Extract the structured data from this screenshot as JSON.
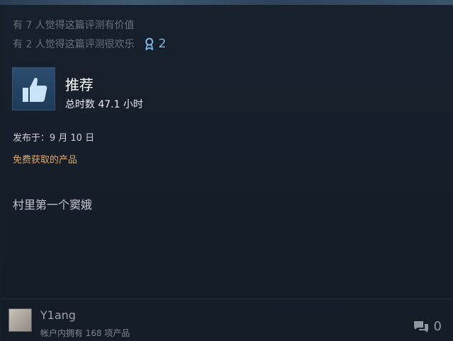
{
  "helpful": {
    "useful_text": "有 7 人觉得这篇评测有价值",
    "funny_text": "有 2 人觉得这篇评测很欢乐",
    "award_count": "2"
  },
  "review": {
    "recommendation": "推荐",
    "playtime": "总时数 47.1 小时",
    "posted": "发布于：9 月 10 日",
    "free_product": "免费获取的产品",
    "body": "村里第一个窦娥"
  },
  "author": {
    "name": "Y1ang",
    "products_owned": "帐户内拥有 168 项产品"
  },
  "comments": {
    "count": "0"
  },
  "icons": {
    "thumb": "thumbs-up-icon",
    "award": "award-ribbon-icon",
    "comment": "comment-bubble-icon"
  },
  "colors": {
    "background": "#161e28",
    "accent_blue": "#7ab6e6",
    "free_orange": "#e0a86b"
  }
}
